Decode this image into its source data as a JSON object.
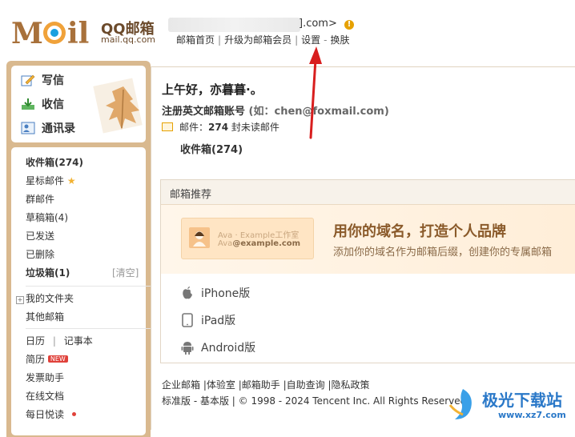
{
  "header": {
    "logo_text": "MOil",
    "logo_brand": "QQ邮箱",
    "logo_url": "mail.qq.com",
    "account_tail": "].com>",
    "links": [
      "邮箱首页",
      "升级为邮箱会员",
      "设置",
      "换肤"
    ]
  },
  "sidebar": {
    "compose": "写信",
    "receive": "收信",
    "contacts": "通讯录",
    "folders": [
      {
        "label": "收件箱(274)"
      },
      {
        "label": "星标邮件"
      },
      {
        "label": "群邮件"
      },
      {
        "label": "草稿箱(4)"
      },
      {
        "label": "已发送"
      },
      {
        "label": "已删除"
      },
      {
        "label": "垃圾箱(1)"
      }
    ],
    "clear": "[清空]",
    "my_folders": "我的文件夹",
    "other_mail": "其他邮箱",
    "apps": [
      {
        "label": "日历"
      },
      {
        "label": "记事本"
      },
      {
        "label": "简历"
      },
      {
        "label": "发票助手"
      },
      {
        "label": "在线文档"
      },
      {
        "label": "每日悦读"
      }
    ],
    "new_badge": "NEW"
  },
  "main": {
    "greeting": "上午好，亦暮暮·。",
    "register": "注册英文邮箱账号",
    "register_hint": "(如：chen@foxmail.com)",
    "mail_prefix": "邮件：",
    "unread_count": "274",
    "unread_suffix": "封未读邮件",
    "inbox_link": "收件箱(274)",
    "rec_title": "邮箱推荐",
    "promo_line1": "Ava · Example工作室",
    "promo_line2_a": "Ava",
    "promo_line2_b": "@example.com",
    "promo_head": "用你的域名，打造个人品牌",
    "promo_sub": "添加你的域名作为邮箱后缀，创建你的专属邮箱",
    "devices": [
      "iPhone版",
      "iPad版",
      "Android版"
    ]
  },
  "footer": {
    "links": [
      "企业邮箱",
      "体验室",
      "邮箱助手",
      "自助查询",
      "隐私政策"
    ],
    "line2": "标准版 - 基本版 | © 1998 - 2024 Tencent Inc. All Rights Reserved"
  },
  "watermark": {
    "text": "极光下载站",
    "url": "www.xz7.com"
  },
  "colors": {
    "sidebar_bg": "#d9b98f",
    "arrow": "#d81e1e",
    "badge": "#e0413a"
  }
}
